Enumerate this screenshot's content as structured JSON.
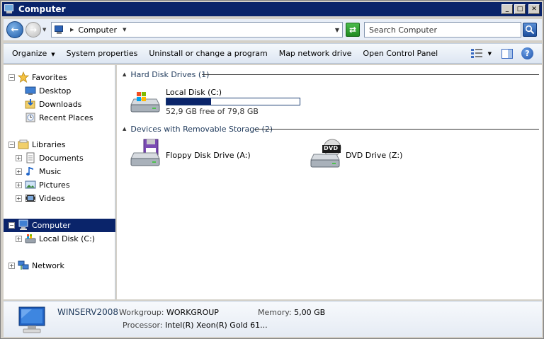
{
  "window": {
    "title": "Computer"
  },
  "address": {
    "crumb": "Computer"
  },
  "search": {
    "placeholder": "Search Computer"
  },
  "commands": {
    "organize": "Organize",
    "system_properties": "System properties",
    "uninstall": "Uninstall or change a program",
    "map_drive": "Map network drive",
    "control_panel": "Open Control Panel"
  },
  "nav": {
    "favorites": {
      "label": "Favorites",
      "items": [
        "Desktop",
        "Downloads",
        "Recent Places"
      ]
    },
    "libraries": {
      "label": "Libraries",
      "items": [
        "Documents",
        "Music",
        "Pictures",
        "Videos"
      ]
    },
    "computer": {
      "label": "Computer",
      "items": [
        "Local Disk (C:)"
      ]
    },
    "network": {
      "label": "Network"
    }
  },
  "groups": {
    "hdd": {
      "header": "Hard Disk Drives (1)",
      "drive": {
        "name": "Local Disk (C:)",
        "free": "52,9 GB free of 79,8 GB",
        "used_fraction": 0.337
      }
    },
    "removable": {
      "header": "Devices with Removable Storage (2)",
      "floppy": "Floppy Disk Drive (A:)",
      "dvd": "DVD Drive (Z:)",
      "dvd_badge": "DVD"
    }
  },
  "details": {
    "name": "WINSERV2008",
    "workgroup_label": "Workgroup:",
    "workgroup": "WORKGROUP",
    "memory_label": "Memory:",
    "memory": "5,00 GB",
    "processor_label": "Processor:",
    "processor": "Intel(R) Xeon(R) Gold 61..."
  },
  "colors": {
    "selection": "#0a246a",
    "titlebar": "#0a246a"
  }
}
